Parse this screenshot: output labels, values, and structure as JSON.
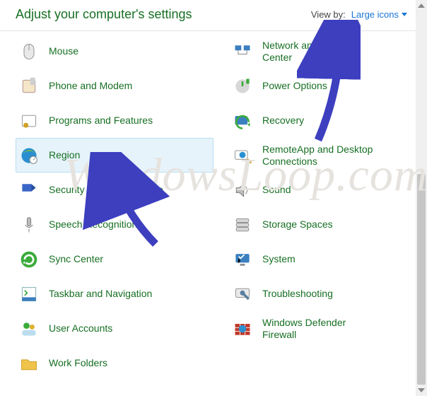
{
  "header": {
    "title": "Adjust your computer's settings",
    "view_by_label": "View by:",
    "view_by_value": "Large icons"
  },
  "left_items": [
    {
      "label": "Mouse",
      "icon": "mouse-icon",
      "selected": false
    },
    {
      "label": "Phone and Modem",
      "icon": "phone-icon",
      "selected": false
    },
    {
      "label": "Programs and Features",
      "icon": "programs-icon",
      "selected": false
    },
    {
      "label": "Region",
      "icon": "region-icon",
      "selected": true
    },
    {
      "label": "Security and Maintenance",
      "icon": "security-icon",
      "selected": false
    },
    {
      "label": "Speech Recognition",
      "icon": "speech-icon",
      "selected": false
    },
    {
      "label": "Sync Center",
      "icon": "sync-icon",
      "selected": false
    },
    {
      "label": "Taskbar and Navigation",
      "icon": "taskbar-icon",
      "selected": false
    },
    {
      "label": "User Accounts",
      "icon": "users-icon",
      "selected": false
    },
    {
      "label": "Work Folders",
      "icon": "folders-icon",
      "selected": false
    }
  ],
  "right_items": [
    {
      "label": "Network and Sharing Center",
      "icon": "network-icon",
      "selected": false
    },
    {
      "label": "Power Options",
      "icon": "power-icon",
      "selected": false
    },
    {
      "label": "Recovery",
      "icon": "recovery-icon",
      "selected": false
    },
    {
      "label": "RemoteApp and Desktop Connections",
      "icon": "remoteapp-icon",
      "selected": false
    },
    {
      "label": "Sound",
      "icon": "sound-icon",
      "selected": false
    },
    {
      "label": "Storage Spaces",
      "icon": "storage-icon",
      "selected": false
    },
    {
      "label": "System",
      "icon": "system-icon",
      "selected": false
    },
    {
      "label": "Troubleshooting",
      "icon": "troubleshoot-icon",
      "selected": false
    },
    {
      "label": "Windows Defender Firewall",
      "icon": "firewall-icon",
      "selected": false
    }
  ],
  "watermark": "WindowsLoop.com",
  "annotations": {
    "arrow1_target": "view-by-dropdown",
    "arrow2_target": "region-item"
  }
}
